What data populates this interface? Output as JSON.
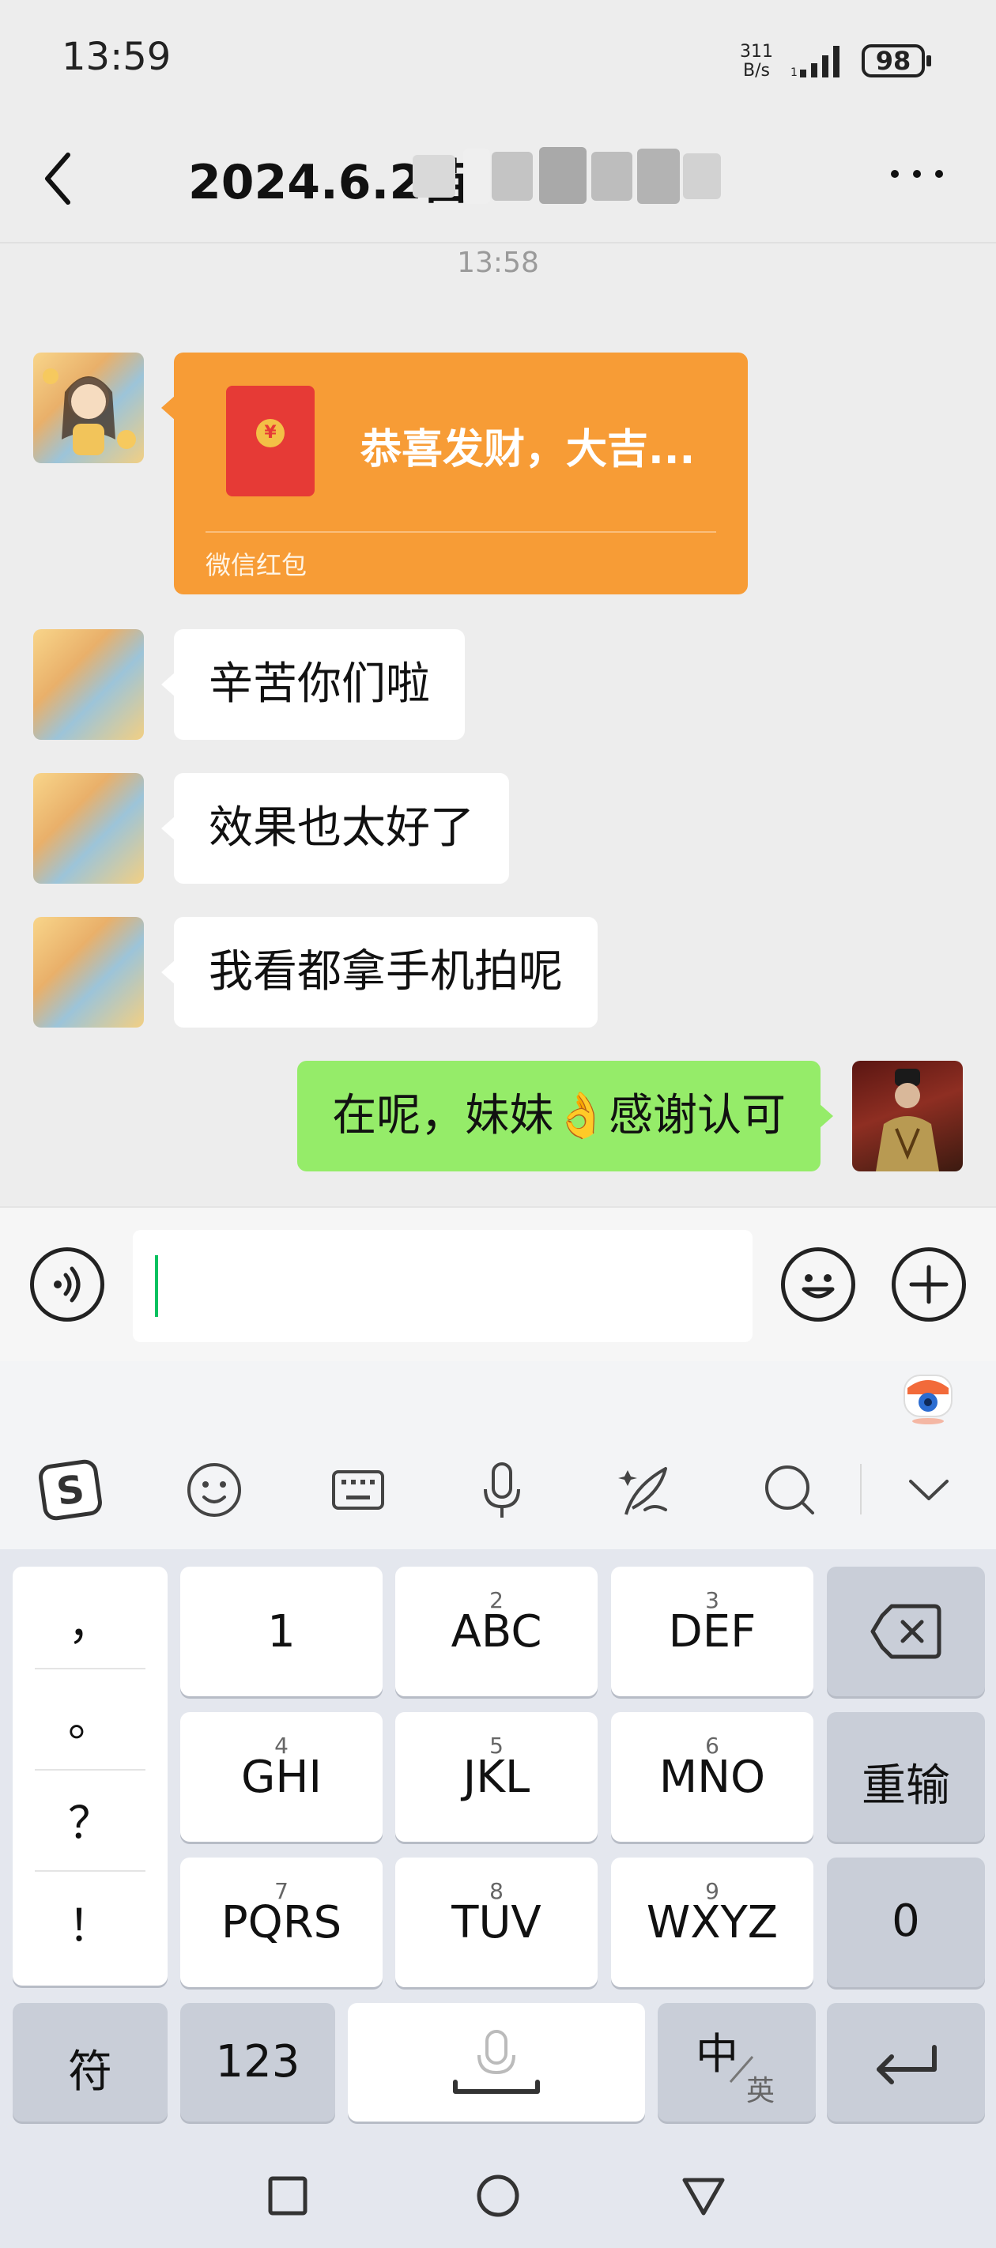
{
  "status_bar": {
    "time": "13:59",
    "net_speed_value": "311",
    "net_speed_unit": "B/s",
    "battery": "98"
  },
  "nav": {
    "title": "2024.6.2苗"
  },
  "chat": {
    "timestamp": "13:58",
    "red_packet": {
      "title": "恭喜发财，大吉...",
      "label": "微信红包",
      "symbol": "¥"
    },
    "messages": [
      {
        "text": "辛苦你们啦",
        "side": "in"
      },
      {
        "text": "效果也太好了",
        "side": "in"
      },
      {
        "text": "我看都拿手机拍呢",
        "side": "in"
      },
      {
        "text": "在呢，妹妹👌感谢认可",
        "side": "out"
      }
    ]
  },
  "keyboard": {
    "punctuation": [
      "，",
      "。",
      "？",
      "！"
    ],
    "rows": [
      [
        {
          "num": "",
          "label": "1"
        },
        {
          "num": "2",
          "label": "ABC"
        },
        {
          "num": "3",
          "label": "DEF"
        }
      ],
      [
        {
          "num": "4",
          "label": "GHI"
        },
        {
          "num": "5",
          "label": "JKL"
        },
        {
          "num": "6",
          "label": "MNO"
        }
      ],
      [
        {
          "num": "7",
          "label": "PQRS"
        },
        {
          "num": "8",
          "label": "TUV"
        },
        {
          "num": "9",
          "label": "WXYZ"
        }
      ]
    ],
    "side_keys": [
      "重输",
      "0"
    ],
    "bottom": {
      "symbols": "符",
      "numbers": "123",
      "lang_main": "中",
      "lang_sub": "英"
    }
  },
  "colors": {
    "accent_green": "#07c160",
    "bubble_out": "#95ec69",
    "red_packet": "#f79c36"
  }
}
